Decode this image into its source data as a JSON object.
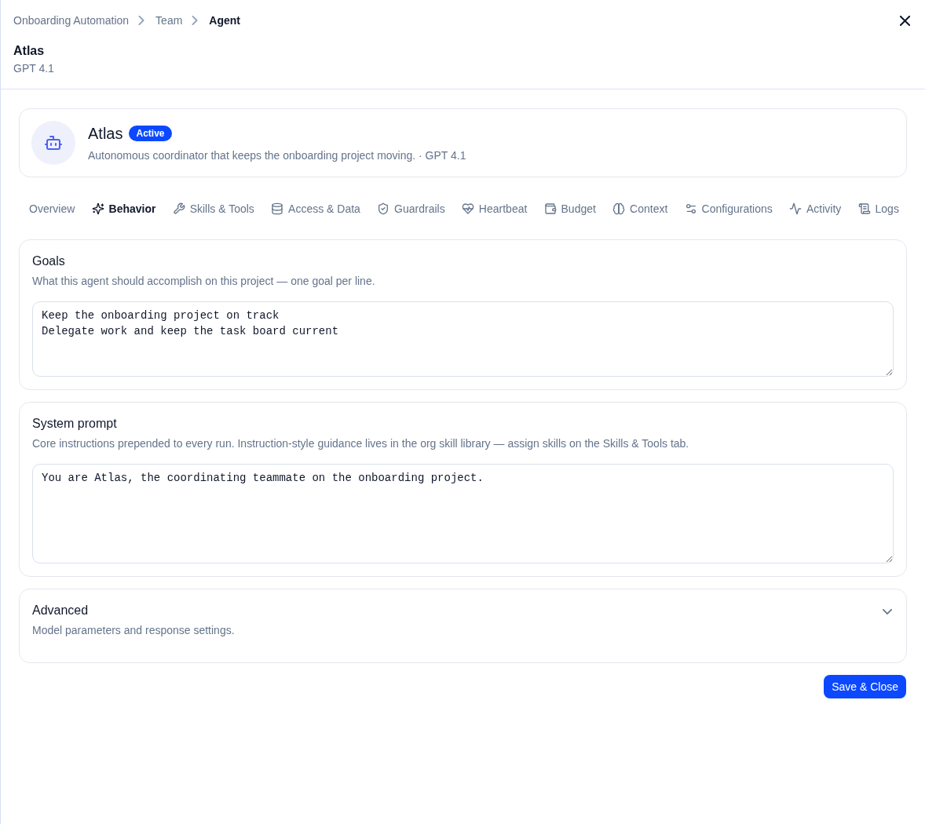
{
  "breadcrumb": [
    {
      "label": "Onboarding Automation",
      "current": false
    },
    {
      "label": "Team",
      "current": false
    },
    {
      "label": "Agent",
      "current": true
    }
  ],
  "header": {
    "title": "Atlas",
    "subtitle": "GPT 4.1"
  },
  "agent": {
    "name": "Atlas",
    "status": "Active",
    "description": "Autonomous coordinator that keeps the onboarding project moving. · GPT 4.1"
  },
  "tabs": [
    {
      "label": "Overview",
      "selected": false
    },
    {
      "label": "Behavior",
      "selected": true
    },
    {
      "label": "Skills & Tools",
      "selected": false
    },
    {
      "label": "Access & Data",
      "selected": false
    },
    {
      "label": "Guardrails",
      "selected": false
    },
    {
      "label": "Heartbeat",
      "selected": false
    },
    {
      "label": "Budget",
      "selected": false
    },
    {
      "label": "Context",
      "selected": false
    },
    {
      "label": "Configurations",
      "selected": false
    },
    {
      "label": "Activity",
      "selected": false
    },
    {
      "label": "Logs",
      "selected": false
    }
  ],
  "sections": [
    {
      "kind": "textarea",
      "title": "Goals",
      "description": "What this agent should accomplish on this project — one goal per line.",
      "value": "Keep the onboarding project on track\nDelegate work and keep the task board current"
    },
    {
      "kind": "textarea",
      "title": "System prompt",
      "description": "Core instructions prepended to every run. Instruction-style guidance lives in the org skill library — assign skills on the Skills & Tools tab.",
      "value": "You are Atlas, the coordinating teammate on the onboarding project."
    },
    {
      "kind": "collapsible",
      "title": "Advanced",
      "description": "Model parameters and response settings.",
      "expanded": false
    }
  ],
  "save_button": {
    "label": "Save & Close"
  }
}
